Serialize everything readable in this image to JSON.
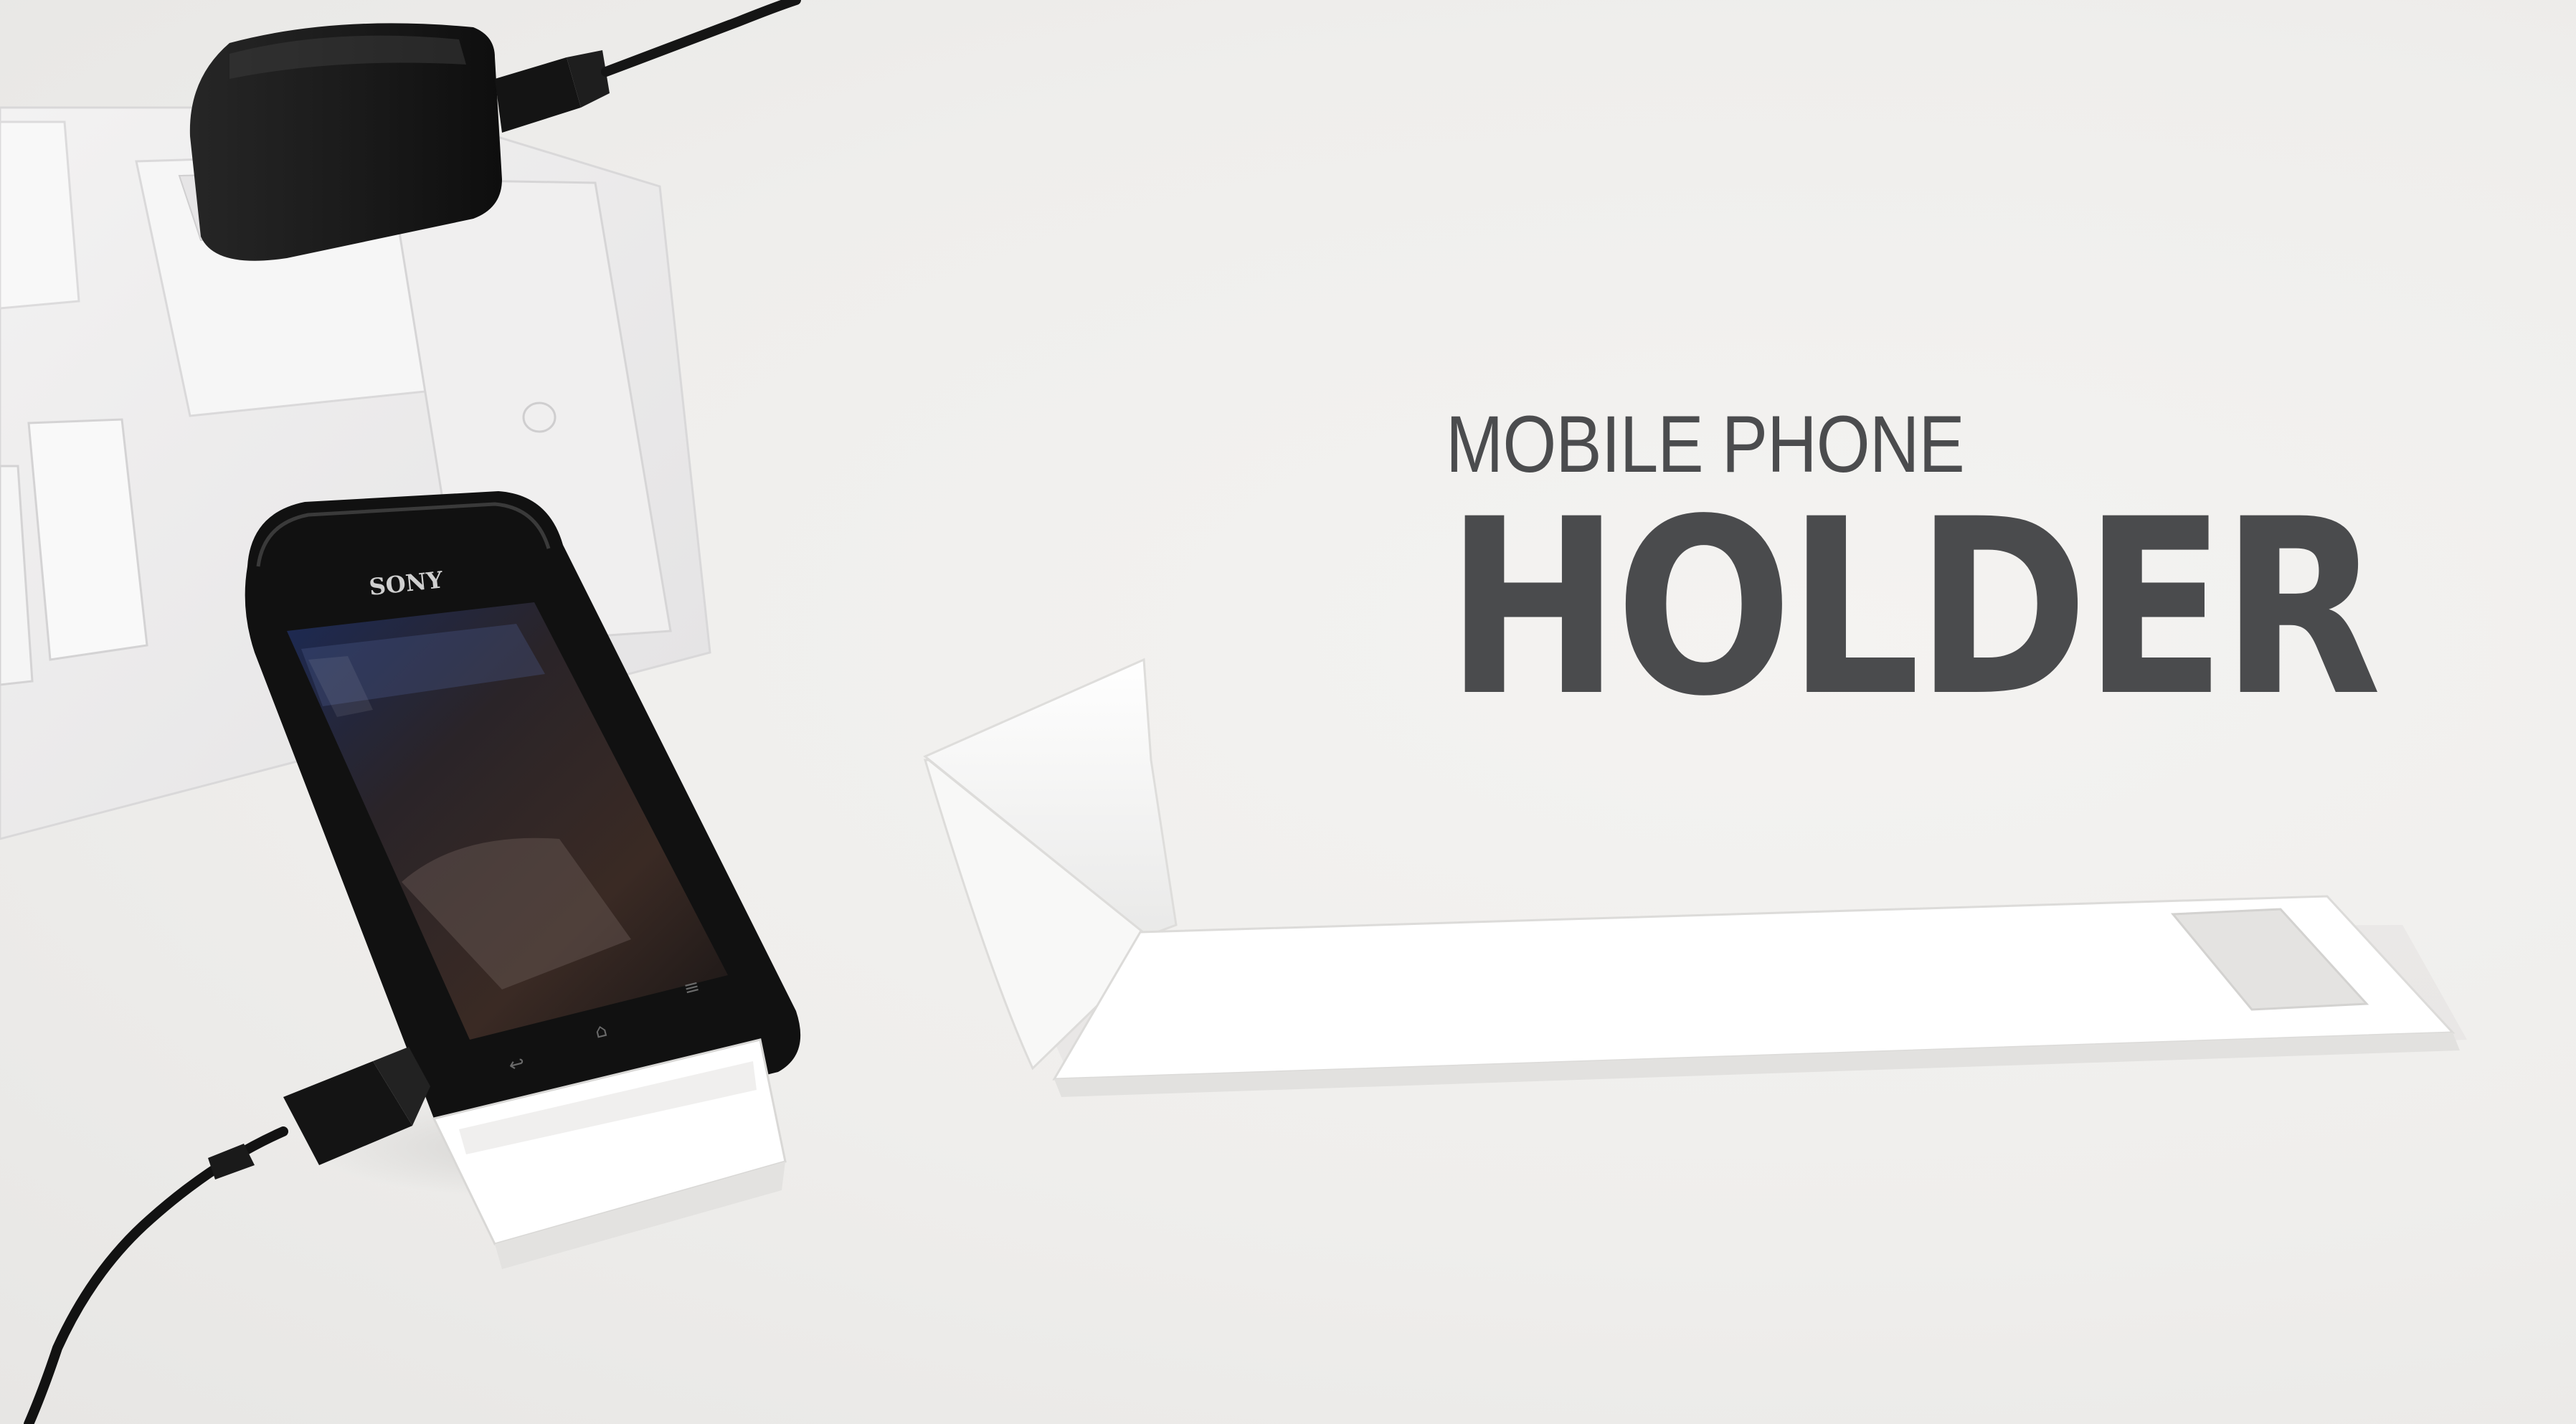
{
  "title": {
    "line1": "MOBILE PHONE",
    "line2": "HOLDER"
  },
  "phone": {
    "brand": "SONY"
  },
  "colors": {
    "background": "#eeedeb",
    "title_text": "#4a4b4d",
    "phone_body": "#121212",
    "holder": "#f7f7f6",
    "charger": "#1a1a1a"
  }
}
